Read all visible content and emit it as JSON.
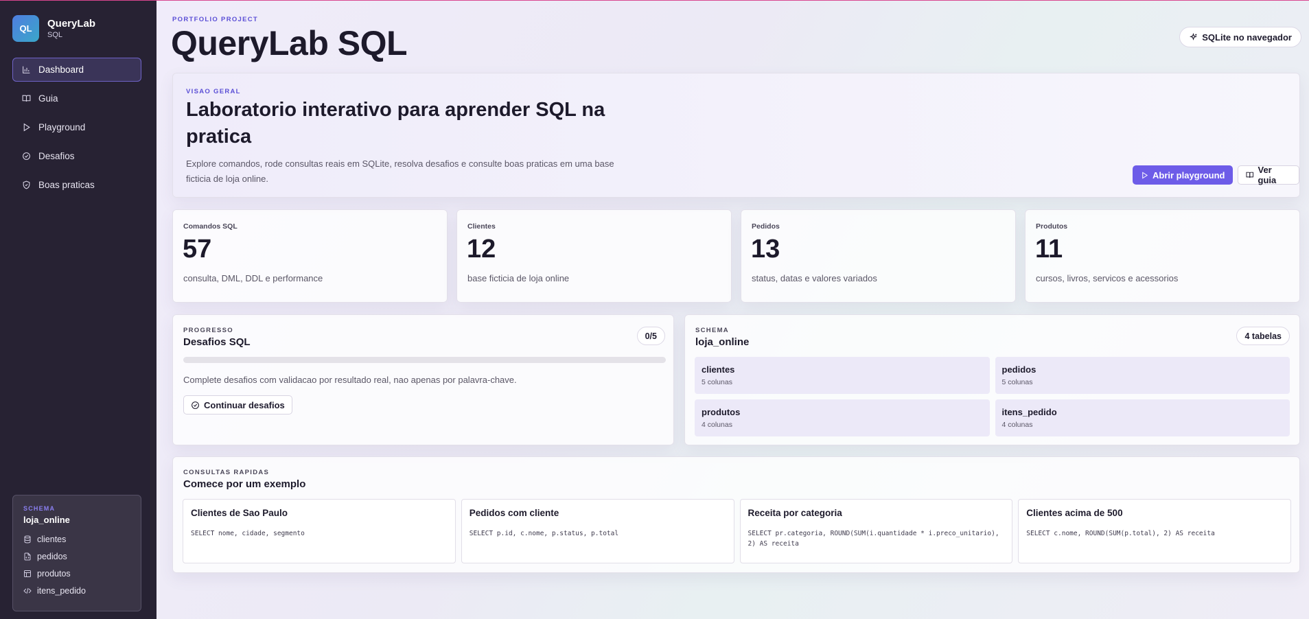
{
  "brand": {
    "logo_text": "QL",
    "name": "QueryLab",
    "subtitle": "SQL"
  },
  "nav": [
    {
      "label": "Dashboard",
      "icon": "bar-chart-icon",
      "active": true
    },
    {
      "label": "Guia",
      "icon": "book-icon",
      "active": false
    },
    {
      "label": "Playground",
      "icon": "play-icon",
      "active": false
    },
    {
      "label": "Desafios",
      "icon": "check-circle-icon",
      "active": false
    },
    {
      "label": "Boas praticas",
      "icon": "shield-icon",
      "active": false
    }
  ],
  "sidebar_schema": {
    "kicker": "SCHEMA",
    "name": "loja_online",
    "tables": [
      {
        "label": "clientes",
        "icon": "database-icon"
      },
      {
        "label": "pedidos",
        "icon": "file-code-icon"
      },
      {
        "label": "produtos",
        "icon": "table-icon"
      },
      {
        "label": "itens_pedido",
        "icon": "code-icon"
      }
    ]
  },
  "header": {
    "kicker": "PORTFOLIO PROJECT",
    "title": "QueryLab SQL",
    "pill_label": "SQLite no navegador"
  },
  "hero": {
    "kicker": "VISAO GERAL",
    "title": "Laboratorio interativo para aprender SQL na pratica",
    "description": "Explore comandos, rode consultas reais em SQLite, resolva desafios e consulte boas praticas em uma base ficticia de loja online.",
    "primary_button": "Abrir playground",
    "secondary_button": "Ver guia"
  },
  "stats": [
    {
      "label": "Comandos SQL",
      "value": "57",
      "description": "consulta, DML, DDL e performance"
    },
    {
      "label": "Clientes",
      "value": "12",
      "description": "base ficticia de loja online"
    },
    {
      "label": "Pedidos",
      "value": "13",
      "description": "status, datas e valores variados"
    },
    {
      "label": "Produtos",
      "value": "11",
      "description": "cursos, livros, servicos e acessorios"
    }
  ],
  "progress": {
    "kicker": "PROGRESSO",
    "title": "Desafios SQL",
    "badge": "0/5",
    "completed_fraction": 0,
    "description": "Complete desafios com validacao por resultado real, nao apenas por palavra-chave.",
    "button": "Continuar desafios"
  },
  "schema": {
    "kicker": "SCHEMA",
    "title": "loja_online",
    "badge": "4 tabelas",
    "tables": [
      {
        "name": "clientes",
        "columns": "5 colunas"
      },
      {
        "name": "pedidos",
        "columns": "5 colunas"
      },
      {
        "name": "produtos",
        "columns": "4 colunas"
      },
      {
        "name": "itens_pedido",
        "columns": "4 colunas"
      }
    ]
  },
  "quick": {
    "kicker": "CONSULTAS RAPIDAS",
    "title": "Comece por um exemplo",
    "examples": [
      {
        "title": "Clientes de Sao Paulo",
        "sql": "SELECT nome, cidade, segmento"
      },
      {
        "title": "Pedidos com cliente",
        "sql": "SELECT p.id, c.nome, p.status, p.total"
      },
      {
        "title": "Receita por categoria",
        "sql": "SELECT pr.categoria, ROUND(SUM(i.quantidade * i.preco_unitario), 2) AS receita"
      },
      {
        "title": "Clientes acima de 500",
        "sql": "SELECT c.nome, ROUND(SUM(p.total), 2) AS receita"
      }
    ]
  },
  "colors": {
    "accent": "#6d5ce8",
    "sidebar_bg": "#272233",
    "top_line": "#d9468f"
  }
}
